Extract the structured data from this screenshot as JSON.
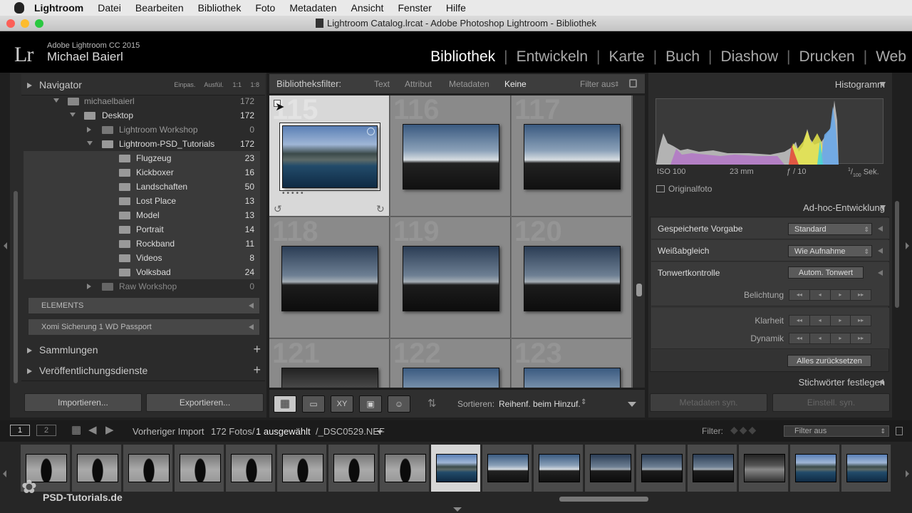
{
  "menubar": {
    "app": "Lightroom",
    "items": [
      "Datei",
      "Bearbeiten",
      "Bibliothek",
      "Foto",
      "Metadaten",
      "Ansicht",
      "Fenster",
      "Hilfe"
    ]
  },
  "window": {
    "title": "Lightroom Catalog.lrcat - Adobe Photoshop Lightroom - Bibliothek"
  },
  "identity": {
    "logo": "Lr",
    "product": "Adobe Lightroom CC 2015",
    "user": "Michael Baierl"
  },
  "modules": [
    "Bibliothek",
    "Entwickeln",
    "Karte",
    "Buch",
    "Diashow",
    "Drucken",
    "Web"
  ],
  "navigator": {
    "title": "Navigator",
    "zoom_options": [
      "Einpas.",
      "Ausfül.",
      "1:1",
      "1:8"
    ]
  },
  "folders": {
    "root": {
      "label": "michaelbaierl",
      "count": "172"
    },
    "desktop": {
      "label": "Desktop",
      "count": "172"
    },
    "items": [
      {
        "label": "Lightroom Workshop",
        "count": "0"
      },
      {
        "label": "Lightroom-PSD_Tutorials",
        "count": "172"
      },
      {
        "label": "Flugzeug",
        "count": "23"
      },
      {
        "label": "Kickboxer",
        "count": "16"
      },
      {
        "label": "Landschaften",
        "count": "50"
      },
      {
        "label": "Lost Place",
        "count": "13"
      },
      {
        "label": "Model",
        "count": "13"
      },
      {
        "label": "Portrait",
        "count": "14"
      },
      {
        "label": "Rockband",
        "count": "11"
      },
      {
        "label": "Videos",
        "count": "8"
      },
      {
        "label": "Volksbad",
        "count": "24"
      },
      {
        "label": "Raw Workshop",
        "count": "0"
      }
    ],
    "volumes": [
      "ELEMENTS",
      "Xomi Sicherung 1 WD Passport"
    ]
  },
  "left_sections": {
    "collections": "Sammlungen",
    "publish": "Veröffentlichungsdienste"
  },
  "left_buttons": {
    "import": "Importieren...",
    "export": "Exportieren..."
  },
  "filterbar": {
    "label": "Bibliotheksfilter:",
    "options": [
      "Text",
      "Attribut",
      "Metadaten",
      "Keine"
    ],
    "filter_status": "Filter aus"
  },
  "grid": {
    "cell_numbers": [
      "115",
      "116",
      "117",
      "118",
      "119",
      "120",
      "121",
      "122",
      "123"
    ]
  },
  "toolbar": {
    "sort_label": "Sortieren:",
    "sort_value": "Reihenf. beim Hinzuf."
  },
  "histogram": {
    "title": "Histogramm",
    "iso": "ISO 100",
    "focal": "23 mm",
    "aperture": "ƒ / 10",
    "shutter_num": "1",
    "shutter_den": "100",
    "shutter_unit": "Sek.",
    "original": "Originalfoto"
  },
  "quick_develop": {
    "title": "Ad-hoc-Entwicklung",
    "saved_preset_label": "Gespeicherte Vorgabe",
    "saved_preset_value": "Standard",
    "wb_label": "Weißabgleich",
    "wb_value": "Wie Aufnahme",
    "tone_label": "Tonwertkontrolle",
    "auto_tone": "Autom. Tonwert",
    "exposure": "Belichtung",
    "clarity": "Klarheit",
    "vibrance": "Dynamik",
    "reset": "Alles zurücksetzen"
  },
  "keywording": {
    "title": "Stichwörter festlegen"
  },
  "right_buttons": {
    "sync_meta": "Metadaten syn.",
    "sync_settings": "Einstell. syn."
  },
  "filmstrip_bar": {
    "view1": "1",
    "view2": "2",
    "source": "Vorheriger Import",
    "count": "172 Fotos/",
    "selected": "1 ausgewählt",
    "file": "/_DSC0529.NEF",
    "filter_label": "Filter:",
    "filter_value": "Filter aus"
  },
  "watermark": "PSD-Tutorials.de"
}
